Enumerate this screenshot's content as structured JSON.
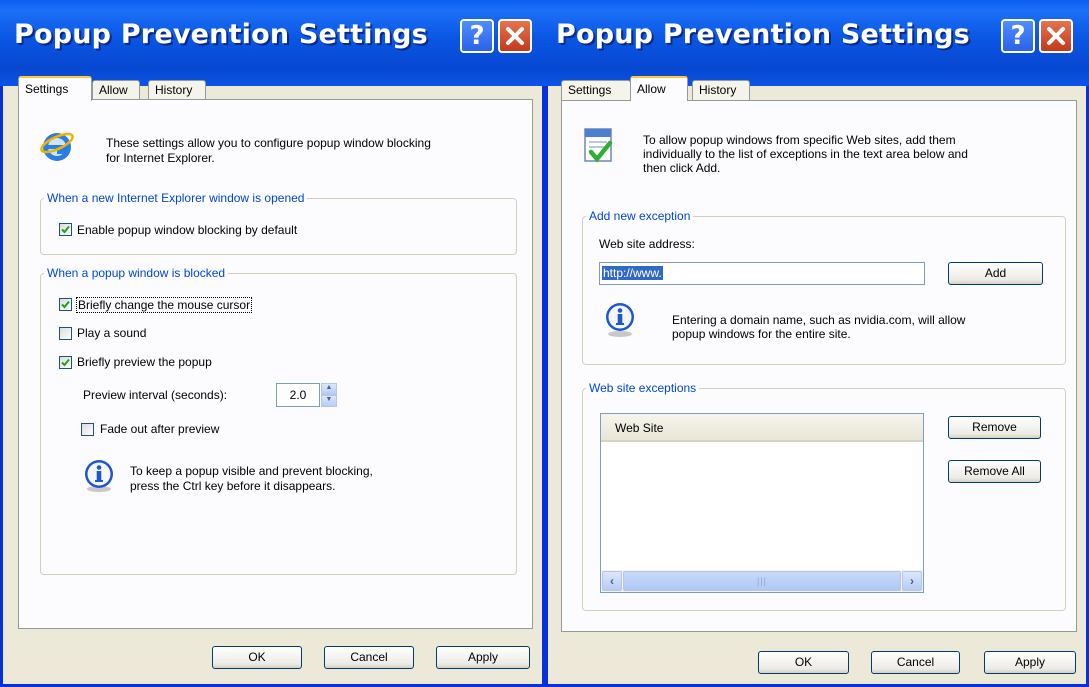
{
  "colors": {
    "titlebar": "#0a56e4",
    "group_label": "#0046d5",
    "window_body": "#ece9d8",
    "focus_tab": "#ffc83c"
  },
  "left_dialog": {
    "title": "Popup Prevention Settings",
    "help_icon": "help-icon",
    "close_icon": "close-icon",
    "tabs": [
      "Settings",
      "Allow",
      "History"
    ],
    "active_tab": "Settings",
    "ie_icon": "internet-explorer-icon",
    "description": [
      "These settings allow you to configure popup window blocking",
      "for Internet Explorer."
    ],
    "group_new_window": {
      "label": "When a new Internet Explorer window is opened",
      "enable_blocking": {
        "label": "Enable popup window blocking by default",
        "checked": true
      }
    },
    "group_blocked": {
      "label": "When a popup window is blocked",
      "change_cursor": {
        "label": "Briefly change the mouse cursor",
        "checked": true
      },
      "play_sound": {
        "label": "Play a sound",
        "checked": false
      },
      "preview_popup": {
        "label": "Briefly preview the popup",
        "checked": true
      },
      "preview_interval_label": "Preview interval (seconds):",
      "preview_interval_value": "2.0",
      "fade_out": {
        "label": "Fade out after preview",
        "checked": false
      },
      "info_icon": "info-icon",
      "info_text": [
        "To keep a popup visible and prevent blocking,",
        "press the Ctrl key before it disappears."
      ]
    },
    "buttons": {
      "ok": "OK",
      "cancel": "Cancel",
      "apply": "Apply"
    }
  },
  "right_dialog": {
    "title": "Popup Prevention Settings",
    "help_icon": "help-icon",
    "close_icon": "close-icon",
    "tabs": [
      "Settings",
      "Allow",
      "History"
    ],
    "active_tab": "Allow",
    "allow_icon": "allow-list-icon",
    "description": [
      "To allow popup windows from specific Web sites, add them",
      "individually to the list of exceptions in the text area below and",
      "then click Add."
    ],
    "group_add": {
      "label": "Add new exception",
      "address_label": "Web site address:",
      "address_value": "http://www.",
      "add_button": "Add",
      "info_icon": "info-icon",
      "info_text": [
        "Entering a domain name, such as nvidia.com, will allow",
        "popup windows for the entire site."
      ]
    },
    "group_exceptions": {
      "label": "Web site exceptions",
      "column_header": "Web Site",
      "rows": [],
      "remove_button": "Remove",
      "remove_all_button": "Remove All"
    },
    "buttons": {
      "ok": "OK",
      "cancel": "Cancel",
      "apply": "Apply"
    }
  }
}
